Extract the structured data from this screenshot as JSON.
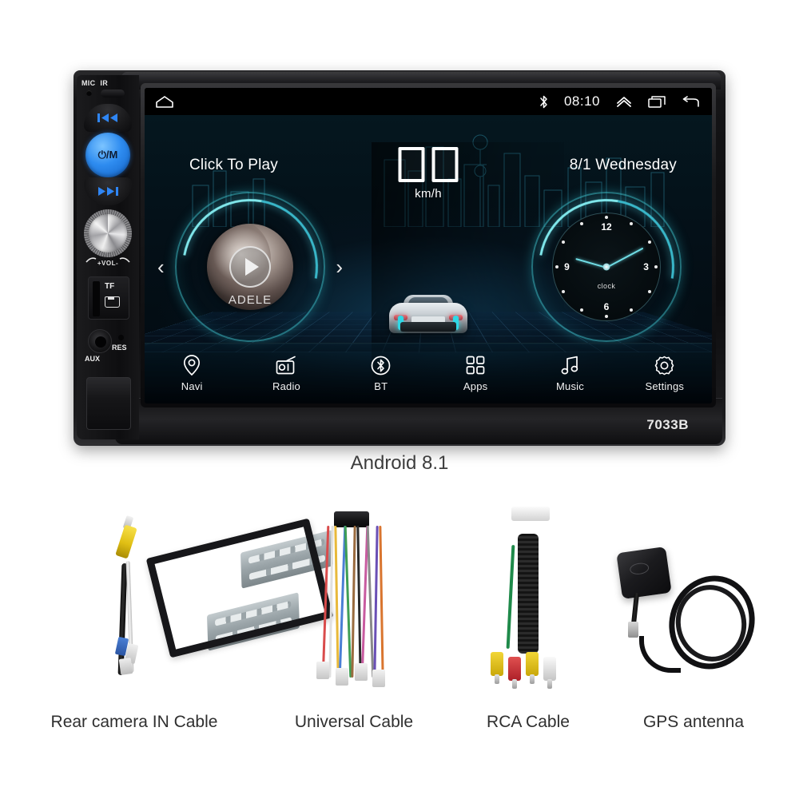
{
  "product": {
    "model_badge": "7033B",
    "os_caption": "Android 8.1"
  },
  "head_unit": {
    "panel_labels": {
      "mic": "MIC",
      "ir": "IR",
      "power": "⏻/M",
      "volume": "+VOL-",
      "tf": "TF",
      "aux": "AUX",
      "res": "RES"
    },
    "buttons": {
      "prev_icon": "previous-track-icon",
      "next_icon": "next-track-icon",
      "power_icon": "power-mode-icon",
      "volume_knob_icon": "volume-knob"
    }
  },
  "screen": {
    "status_bar": {
      "home_icon": "home-icon",
      "bluetooth_icon": "bluetooth-icon",
      "clock": "08:10",
      "expand_icon": "chevron-up-icon",
      "recents_icon": "recent-apps-icon",
      "back_icon": "back-arrow-icon"
    },
    "hint_text": "Click To Play",
    "date_text": "8/1 Wednesday",
    "speed": {
      "digit_1": "",
      "digit_2": "",
      "unit": "km/h"
    },
    "music_widget": {
      "artist": "ADELE",
      "play_icon": "play-icon",
      "prev_arrow": "‹",
      "next_arrow": "›"
    },
    "clock_widget": {
      "label": "clock",
      "numerals": [
        "12",
        "3",
        "6",
        "9"
      ]
    },
    "dock": [
      {
        "label": "Navi",
        "icon": "map-pin-icon"
      },
      {
        "label": "Radio",
        "icon": "radio-icon"
      },
      {
        "label": "BT",
        "icon": "bluetooth-icon"
      },
      {
        "label": "Apps",
        "icon": "grid-apps-icon"
      },
      {
        "label": "Music",
        "icon": "music-note-icon"
      },
      {
        "label": "Settings",
        "icon": "gear-icon"
      }
    ]
  },
  "accessories": [
    {
      "caption": "Rear camera IN Cable"
    },
    {
      "caption": "Universal Cable"
    },
    {
      "caption": "RCA Cable"
    },
    {
      "caption": "GPS antenna"
    }
  ],
  "colors": {
    "accent_teal": "#3cc8d2",
    "accent_blue": "#2e8cf0",
    "screen_bg": "#04080b",
    "chassis": "#121214",
    "text_light": "#ffffff",
    "caption_text": "#2f2f2f"
  }
}
